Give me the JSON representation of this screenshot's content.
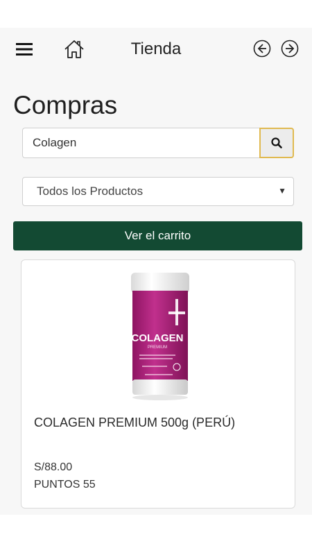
{
  "header": {
    "title": "Tienda",
    "icons": {
      "menu": "hamburger-menu-icon",
      "home": "home-icon",
      "back": "circle-arrow-left-icon",
      "forward": "circle-arrow-right-icon"
    }
  },
  "page": {
    "title": "Compras"
  },
  "search": {
    "value": "Colagen",
    "placeholder": "",
    "icon": "search-icon"
  },
  "filter": {
    "selected": "Todos los Productos"
  },
  "cart_button": {
    "label": "Ver el carrito"
  },
  "products": [
    {
      "name": "COLAGEN PREMIUM 500g (PERÚ)",
      "price": "S/88.00",
      "points": "PUNTOS 55",
      "image_brand": "COLAGEN",
      "image_sub": "PREMIUM"
    }
  ],
  "colors": {
    "accent_green": "#134a33",
    "search_border": "#e0b94f",
    "product_purple": "#b0257c"
  }
}
